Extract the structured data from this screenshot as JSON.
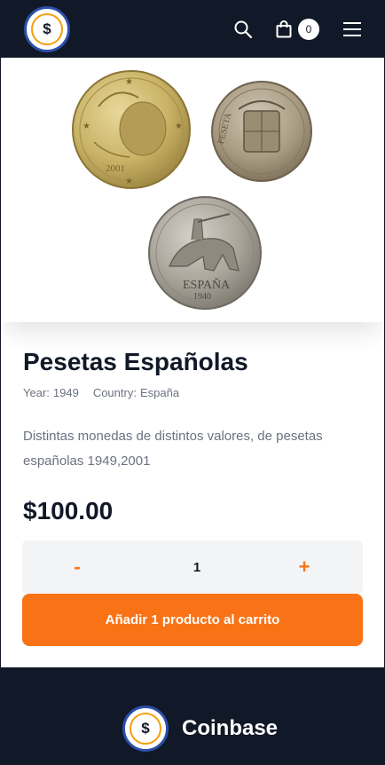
{
  "header": {
    "logo_symbol": "$",
    "search_icon": "search-icon",
    "cart_icon": "shopping-bag-icon",
    "cart_count": "0",
    "menu_icon": "hamburger-menu-icon"
  },
  "product": {
    "title": "Pesetas Españolas",
    "year_label": "Year:",
    "year": "1949",
    "country_label": "Country:",
    "country": "España",
    "description": "Distintas monedas de distintos valores, de pesetas españolas 1949,2001",
    "price": "$100.00",
    "coin_legends": {
      "euro_year": "2001",
      "peseta_text": "PESETA",
      "espana_text": "ESPAÑA",
      "espana_year": "1940"
    }
  },
  "quantity": {
    "minus": "-",
    "value": "1",
    "plus": "+"
  },
  "cart_button": {
    "label": "Añadir 1 producto al carrito"
  },
  "footer": {
    "logo_symbol": "$",
    "brand": "Coinbase"
  },
  "colors": {
    "navy": "#111827",
    "accent": "#f97316",
    "logo_ring": "#f59e0b",
    "logo_border": "#2b4fa8"
  }
}
